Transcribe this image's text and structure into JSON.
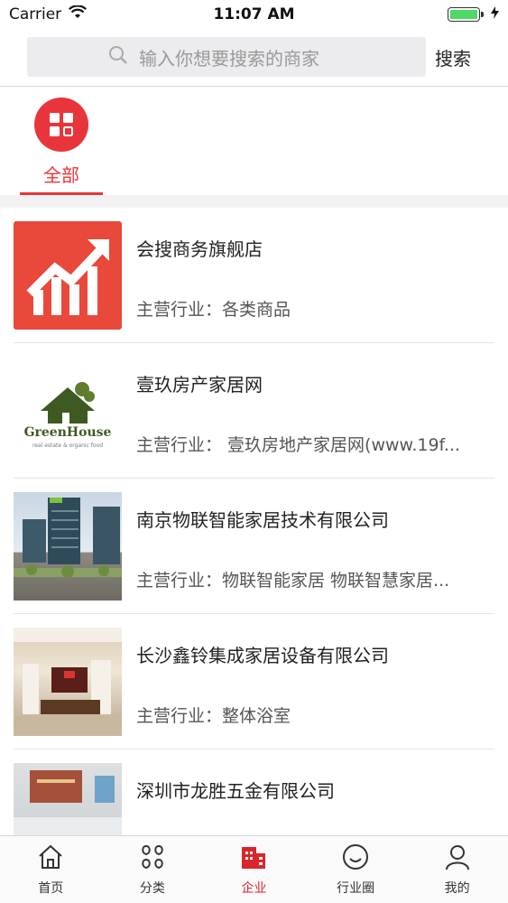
{
  "status": {
    "carrier": "Carrier",
    "time": "11:07 AM",
    "battery_level": 1.0
  },
  "search": {
    "placeholder": "输入你想要搜索的商家",
    "button_label": "搜索"
  },
  "category": {
    "label": "全部"
  },
  "list": {
    "items": [
      {
        "title": "会搜商务旗舰店",
        "subtitle": "主营行业：各类商品",
        "thumb": "chart-growth"
      },
      {
        "title": "壹玖房产家居网",
        "subtitle": "主营行业：  壹玖房地产家居网(www.19f...",
        "thumb": "greenhouse-logo",
        "logo_text": "GreenHouse",
        "logo_tagline": "real estate & organic food"
      },
      {
        "title": "南京物联智能家居技术有限公司",
        "subtitle": "主营行业：物联智能家居 物联智慧家居...",
        "thumb": "photo-buildings"
      },
      {
        "title": "长沙鑫铃集成家居设备有限公司",
        "subtitle": "主营行业：整体浴室",
        "thumb": "photo-lobby"
      },
      {
        "title": "深圳市龙胜五金有限公司",
        "subtitle": "",
        "thumb": "photo-office"
      }
    ]
  },
  "tabbar": {
    "tabs": [
      {
        "label": "首页",
        "icon": "home-icon"
      },
      {
        "label": "分类",
        "icon": "category-icon"
      },
      {
        "label": "企业",
        "icon": "enterprise-icon",
        "active": true
      },
      {
        "label": "行业圈",
        "icon": "circle-icon"
      },
      {
        "label": "我的",
        "icon": "user-icon"
      }
    ]
  },
  "colors": {
    "accent": "#e8353b",
    "active_tab": "#d9262b"
  }
}
